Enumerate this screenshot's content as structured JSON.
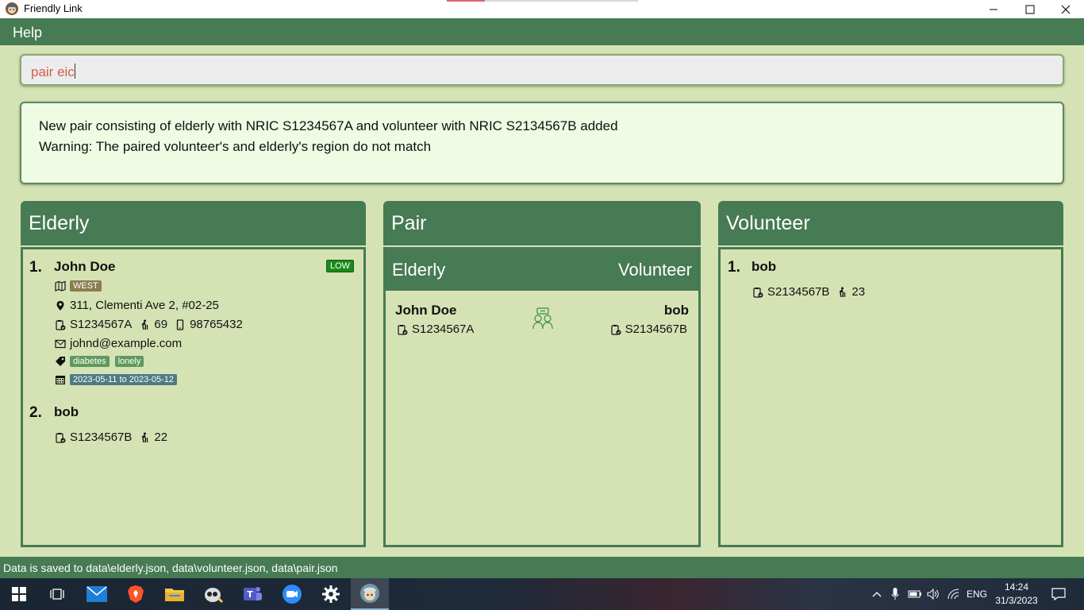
{
  "window": {
    "title": "Friendly Link"
  },
  "menu": {
    "help": "Help"
  },
  "command": {
    "value": "pair eic"
  },
  "result": {
    "line1": "New pair consisting of elderly with NRIC S1234567A and volunteer with NRIC S2134567B added",
    "line2": "Warning: The paired volunteer's and elderly's region do not match"
  },
  "elderly": {
    "title": "Elderly",
    "items": [
      {
        "index": "1.",
        "name": "John Doe",
        "risk": "LOW",
        "region": "WEST",
        "address": "311, Clementi Ave 2, #02-25",
        "nric": "S1234567A",
        "age": "69",
        "phone": "98765432",
        "email": "johnd@example.com",
        "tags": [
          "diabetes",
          "lonely"
        ],
        "availability": "2023-05-11 to 2023-05-12"
      },
      {
        "index": "2.",
        "name": "bob",
        "nric": "S1234567B",
        "age": "22"
      }
    ]
  },
  "pair": {
    "title": "Pair",
    "elderly_header": "Elderly",
    "volunteer_header": "Volunteer",
    "items": [
      {
        "elderly_name": "John Doe",
        "elderly_nric": "S1234567A",
        "volunteer_name": "bob",
        "volunteer_nric": "S2134567B"
      }
    ]
  },
  "volunteer": {
    "title": "Volunteer",
    "items": [
      {
        "index": "1.",
        "name": "bob",
        "nric": "S2134567B",
        "age": "23"
      }
    ]
  },
  "status": {
    "text": "Data is saved to data\\elderly.json, data\\volunteer.json, data\\pair.json"
  },
  "taskbar": {
    "apps": [
      "windows-start",
      "task-view",
      "mail",
      "brave",
      "file-explorer",
      "app-bug",
      "teams",
      "zoom",
      "settings",
      "friendly-link"
    ],
    "language": "ENG",
    "time": "14:24",
    "date": "31/3/2023"
  },
  "colors": {
    "accent": "#467b54",
    "background": "#d5e3b4",
    "risk_low": "#1b8a1b",
    "region_tag": "#8b7d50",
    "tag": "#5e9a5b",
    "availability_tag": "#4f7a82"
  }
}
